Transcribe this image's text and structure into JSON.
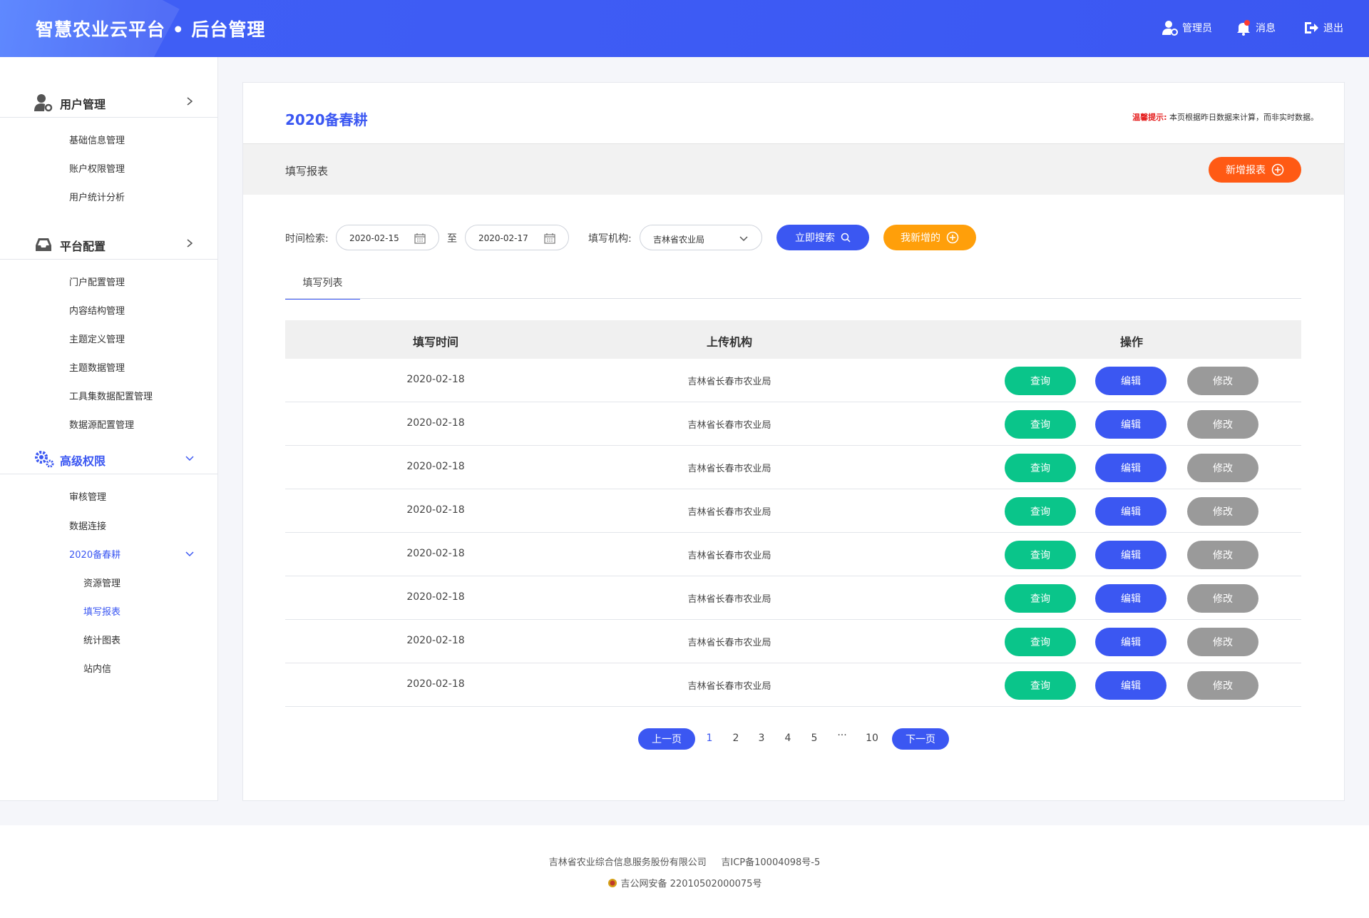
{
  "app": {
    "title": "智慧农业云平台 • 后台管理",
    "admin_label": "管理员",
    "message_label": "消息",
    "logout_label": "退出"
  },
  "sidebar": {
    "groups": [
      {
        "label": "用户管理",
        "icon": "user-gear-icon",
        "items": [
          "基础信息管理",
          "账户权限管理",
          "用户统计分析"
        ]
      },
      {
        "label": "平台配置",
        "icon": "inbox-tray-icon",
        "items": [
          "门户配置管理",
          "内容结构管理",
          "主题定义管理",
          "主题数据管理",
          "工具集数据配置管理",
          "数据源配置管理"
        ]
      },
      {
        "label": "高级权限",
        "icon": "gears-icon",
        "items": [
          "审核管理",
          "数据连接",
          "2020备春耕"
        ],
        "subitems": [
          "资源管理",
          "填写报表",
          "统计图表",
          "站内信"
        ]
      }
    ]
  },
  "main": {
    "page_title": "2020备春耕",
    "tip_label": "温馨提示:",
    "tip_text": "本页根据昨日数据来计算，而非实时数据。",
    "section_title": "填写报表",
    "add_report_label": "新增报表",
    "filters": {
      "time_label": "时间检索:",
      "date_from": "2020-02-15",
      "to_label": "至",
      "date_to": "2020-02-17",
      "org_label": "填写机构:",
      "org_value": "吉林省农业局",
      "search_label": "立即搜索",
      "mine_label": "我新增的"
    },
    "tab_label": "填写列表",
    "table": {
      "columns": [
        "填写时间",
        "上传机构",
        "操作"
      ],
      "rows": [
        {
          "date": "2020-02-18",
          "org": "吉林省长春市农业局"
        },
        {
          "date": "2020-02-18",
          "org": "吉林省长春市农业局"
        },
        {
          "date": "2020-02-18",
          "org": "吉林省长春市农业局"
        },
        {
          "date": "2020-02-18",
          "org": "吉林省长春市农业局"
        },
        {
          "date": "2020-02-18",
          "org": "吉林省长春市农业局"
        },
        {
          "date": "2020-02-18",
          "org": "吉林省长春市农业局"
        },
        {
          "date": "2020-02-18",
          "org": "吉林省长春市农业局"
        },
        {
          "date": "2020-02-18",
          "org": "吉林省长春市农业局"
        }
      ],
      "actions": {
        "query": "查询",
        "edit": "编辑",
        "modify": "修改"
      }
    },
    "pagination": {
      "prev_label": "上一页",
      "next_label": "下一页",
      "pages": [
        "1",
        "2",
        "3",
        "4",
        "5",
        "···",
        "10"
      ],
      "current": "1"
    }
  },
  "footer": {
    "company": "吉林省农业综合信息服务股份有限公司",
    "icp": "吉ICP备10004098号-5",
    "police": "吉公网安备 22010502000075号"
  },
  "colors": {
    "primary": "#3b57f2",
    "orange": "#ff5a14",
    "amber": "#ff9f0a",
    "green": "#0ac58a",
    "gray": "#9a9a9a"
  }
}
